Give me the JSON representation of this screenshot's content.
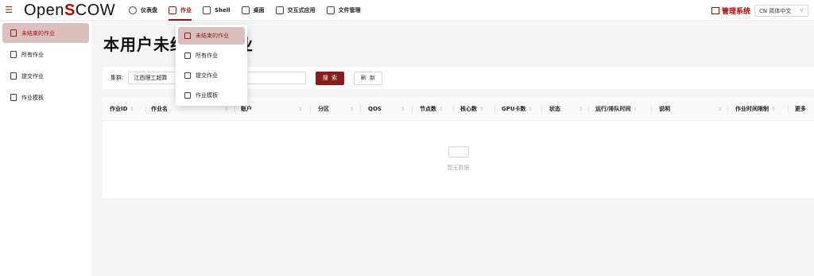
{
  "app": {
    "logo_prefix": "Open",
    "logo_s": "S",
    "logo_suffix": "COW"
  },
  "nav": [
    {
      "label": "仪表盘",
      "icon": "dashboard-icon"
    },
    {
      "label": "作业",
      "icon": "job-icon",
      "active": true
    },
    {
      "label": "Shell",
      "icon": "terminal-icon"
    },
    {
      "label": "桌面",
      "icon": "desktop-icon"
    },
    {
      "label": "交互式应用",
      "icon": "interactive-app-icon"
    },
    {
      "label": "文件管理",
      "icon": "file-icon"
    }
  ],
  "header": {
    "admin_label": "管理系统",
    "lang_label": "CN 简体中文"
  },
  "sidebar": {
    "items": [
      {
        "label": "未结束的作业",
        "icon": "running-job-icon",
        "active": true
      },
      {
        "label": "所有作业",
        "icon": "all-jobs-icon"
      },
      {
        "label": "提交作业",
        "icon": "submit-job-icon"
      },
      {
        "label": "作业模板",
        "icon": "template-icon"
      }
    ]
  },
  "main": {
    "title": "本用户未结束的作业",
    "filter": {
      "cluster_label": "集群:",
      "cluster_value": "江西理工超算",
      "search_label": "搜 索",
      "refresh_label": "刷 新"
    },
    "table": {
      "columns": [
        "作业ID",
        "作业名",
        "账户",
        "分区",
        "QOS",
        "节点数",
        "核心数",
        "GPU卡数",
        "状态",
        "运行/排队时间",
        "说明",
        "作业时间限制",
        "更多"
      ],
      "rows": [],
      "empty_text": "暂无数据"
    }
  },
  "dropdown": {
    "items": [
      {
        "label": "未结束的作业",
        "active": true
      },
      {
        "label": "所有作业"
      },
      {
        "label": "提交作业"
      },
      {
        "label": "作业模板"
      }
    ]
  },
  "colors": {
    "brand": "#8b1a1a",
    "accent_red": "#b20000",
    "active_bg": "#dcc0c0"
  }
}
